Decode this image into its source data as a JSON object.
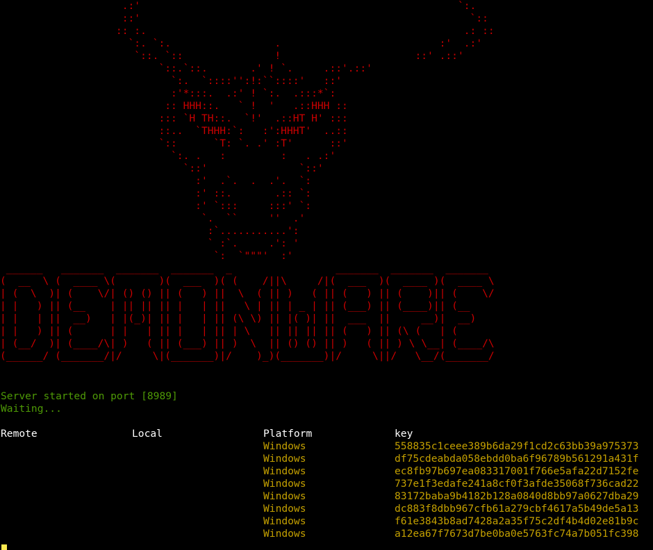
{
  "terminal": {
    "skull_art": [
      "                    .:'                                                    `:.",
      "                    ::'                                                      `::",
      "                   :: :.                                                    .: ::",
      "                     `:. `:.                 .                          :'  .:'",
      "                      `::. `::               !                      ::' .::'",
      "                          `::.`::.       .' ! `.     .::'.::'",
      "                            `:.  `::::'':!:``::::'   ::'",
      "                            :'*:::.  .:' ! `:.  .:::*`:",
      "                           :: HHH::.   ` !  '   .::HHH ::",
      "                          ::: `H TH::.  `!'  .::HT H' :::",
      "                          ::..  `THHH:`:   :':HHHT'  ..::",
      "                          `::      `T: `. .' :T'      ::'",
      "                            `:. .   :         :   . .:'",
      "                              `::'               `::'",
      "                                :'  .`.  .  .'.  `:",
      "                                :' ::.       .:: `:",
      "                                :' `:::     :::' `:",
      "                                 `.  ``     ''  .'",
      "                                  :`...........':",
      "                                  ` :`.     .': '",
      "                                   `:  `\"\"\"'  :'"
    ],
    "logo_art": [
      " ______   _______  _______  _______  _                 _______  _______  _______ ",
      "(  __  \\ (  ____ \\(       )(  ___  )( (    /||\\     /|(  ___  )(  ____ )(  ____ \\",
      "| (  \\  )| (    \\/| () () || (   ) ||  \\  ( || )   ( || (   ) || (    )|| (    \\/",
      "| |   ) || (__    | || || || |   | ||   \\ | || | _ | || (___) || (____)|| (__    ",
      "| |   | ||  __)   | |(_)| || |   | || (\\ \\) || |( )| ||  ___  ||     __)|  __)   ",
      "| |   ) || (      | |   | || |   | || | \\   || || || || (   ) || (\\ (   | (      ",
      "| (__/  )| (____/\\| )   ( || (___) || )  \\  || () () || )   ( || ) \\ \\__| (____/\\",
      "(______/ (_______/|/     \\|(_______)|/    )_)(_______)|/     \\||/   \\__/(_______/"
    ],
    "status_line": "Server started on port [8989]",
    "waiting_line": "Waiting...",
    "table": {
      "headers": {
        "remote": "Remote",
        "local": "Local",
        "platform": "Platform",
        "key": "key"
      },
      "rows": [
        {
          "remote": "",
          "local": "",
          "platform": "Windows",
          "key": "558835c1ceee389b6da29f1cd2c63bb39a975373"
        },
        {
          "remote": "",
          "local": "",
          "platform": "Windows",
          "key": "df75cdeabda058ebdd0ba6f96789b561291a431f"
        },
        {
          "remote": "",
          "local": "",
          "platform": "Windows",
          "key": "ec8fb97b697ea083317001f766e5afa22d7152fe"
        },
        {
          "remote": "",
          "local": "",
          "platform": "Windows",
          "key": "737e1f3edafe241a8cf0f3afde35068f736cad22"
        },
        {
          "remote": "",
          "local": "",
          "platform": "Windows",
          "key": "83172baba9b4182b128a0840d8bb97a0627dba29"
        },
        {
          "remote": "",
          "local": "",
          "platform": "Windows",
          "key": "dc883f8dbb967cfb61a279cbf4617a5b49de5a13"
        },
        {
          "remote": "",
          "local": "",
          "platform": "Windows",
          "key": "f61e3843b8ad7428a2a35f75c2df4b4d02e81b9c"
        },
        {
          "remote": "",
          "local": "",
          "platform": "Windows",
          "key": "a12ea67f7673d7be0ba0e5763fc74a7b051fc398"
        }
      ]
    },
    "colors": {
      "background": "#000000",
      "art": "#cc0000",
      "status": "#4e9a06",
      "header": "#ffffff",
      "rows": "#c4a000",
      "cursor": "#fce94f"
    }
  }
}
